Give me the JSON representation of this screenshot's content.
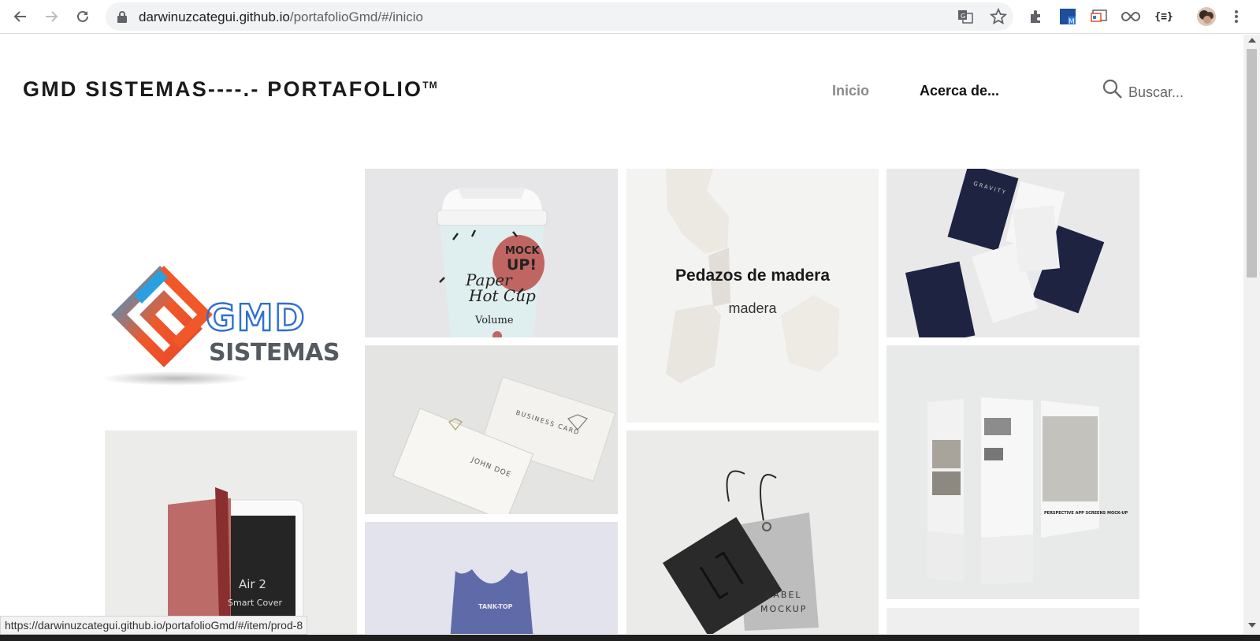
{
  "browser": {
    "url_host": "darwinuzcategui.github.io",
    "url_path": "/portafolioGmd/#/inicio",
    "status_url": "https://darwinuzcategui.github.io/portafolioGmd/#/item/prod-8",
    "extension_label": "{≡}"
  },
  "header": {
    "brand": "GMD SISTEMAS----.- PORTAFOLIO",
    "brand_tm": "TM",
    "nav_inicio": "Inicio",
    "nav_acerca": "Acerca de...",
    "search_placeholder": "Buscar..."
  },
  "logo": {
    "line1": "GMD",
    "line2": "SISTEMAS"
  },
  "items": {
    "cup": {
      "mock_line1": "MOCK",
      "mock_line2": "UP!",
      "paper": "Paper",
      "hotcup": "Hot Cup",
      "volume": "Volume"
    },
    "wood": {
      "title": "Pedazos de madera",
      "category": "madera"
    },
    "cards": {
      "brand": "GRAVITY"
    },
    "bizcard": {
      "label": "BUSINESS CARD",
      "name": "JOHN DOE"
    },
    "app": {
      "title": "PERSPECTIVE APP SCREENS MOCK-UP"
    },
    "ipad": {
      "model": "Air 2",
      "cover": "Smart Cover"
    },
    "tanktop": {
      "label": "TANK-TOP"
    },
    "label_mockup": {
      "line1": "LABEL",
      "line2": "MOCKUP"
    }
  },
  "colors": {
    "accent_orange": "#f0582a",
    "accent_blue": "#2aa0e0",
    "logo_gray": "#555a60"
  }
}
